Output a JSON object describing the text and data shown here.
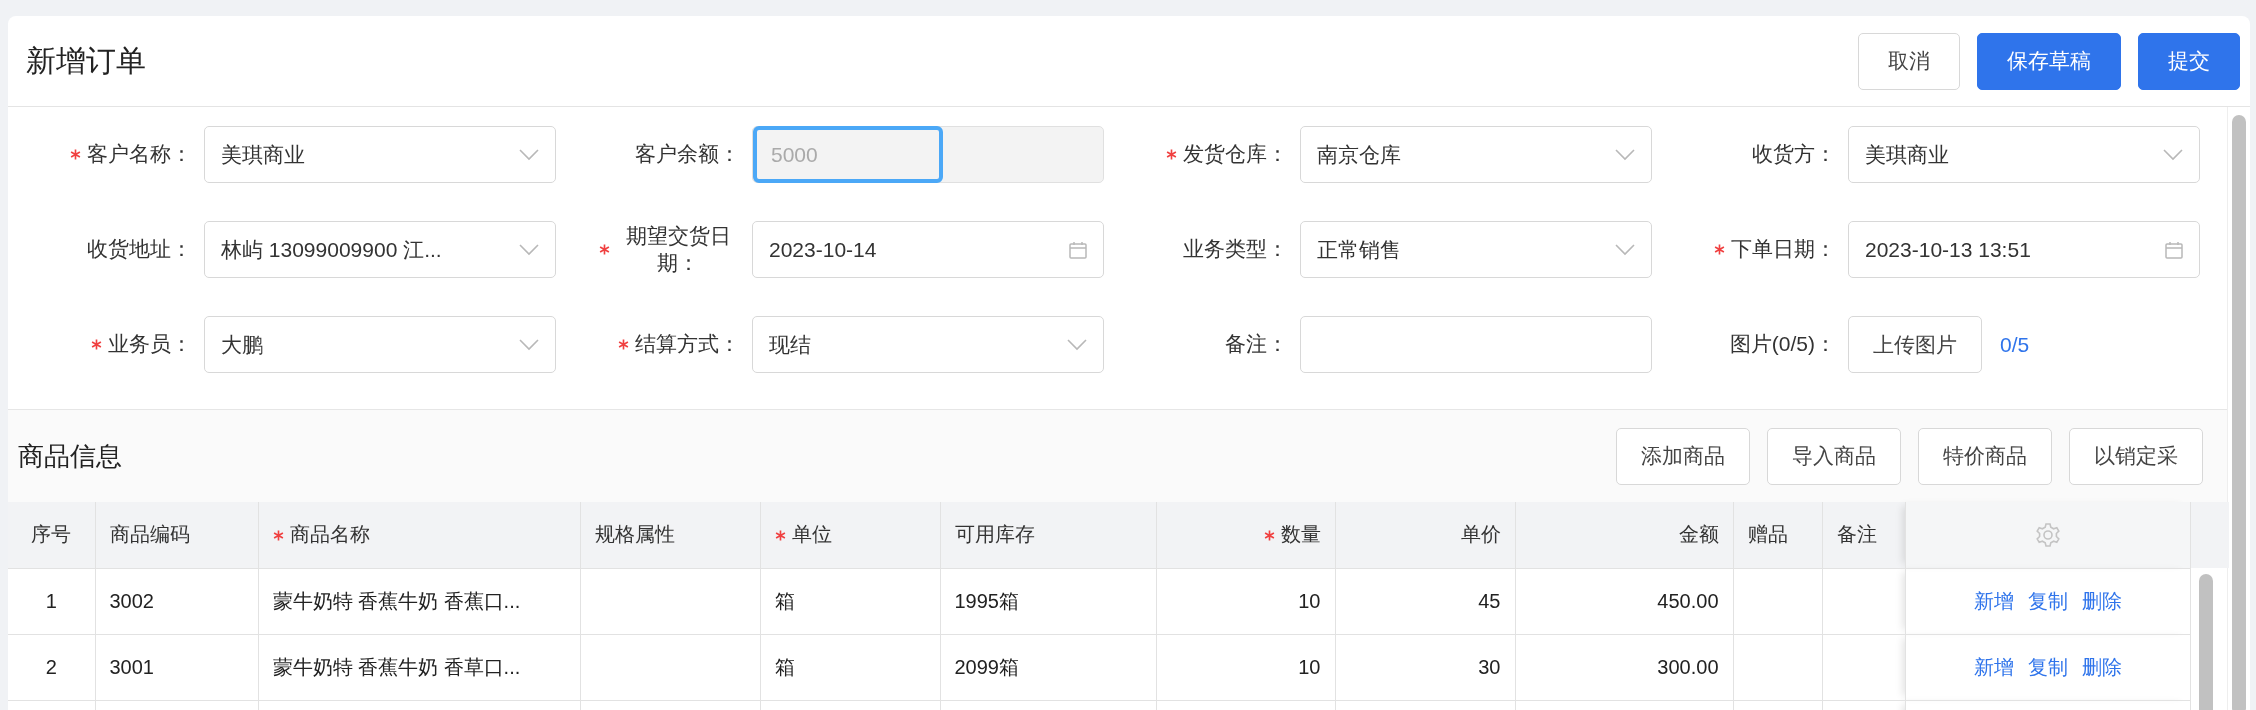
{
  "header": {
    "title": "新增订单",
    "buttons": [
      {
        "label": "取消",
        "kind": "default"
      },
      {
        "label": "保存草稿",
        "kind": "primary"
      },
      {
        "label": "提交",
        "kind": "primary"
      }
    ]
  },
  "form": {
    "fields": [
      {
        "label": "客户名称：",
        "required": true,
        "kind": "select",
        "value": "美琪商业"
      },
      {
        "label": "客户余额：",
        "required": false,
        "kind": "number",
        "value": "5000",
        "disabled": true,
        "focused": true
      },
      {
        "label": "发货仓库：",
        "required": true,
        "kind": "select",
        "value": "南京仓库"
      },
      {
        "label": "收货方：",
        "required": false,
        "kind": "select",
        "value": "美琪商业"
      },
      {
        "label": "收货地址：",
        "required": false,
        "kind": "select",
        "value": "林屿 13099009900 江..."
      },
      {
        "label": "期望交货日期：",
        "required": true,
        "kind": "date",
        "value": "2023-10-14"
      },
      {
        "label": "业务类型：",
        "required": false,
        "kind": "select",
        "value": "正常销售"
      },
      {
        "label": "下单日期：",
        "required": true,
        "kind": "date",
        "value": "2023-10-13 13:51"
      },
      {
        "label": "业务员：",
        "required": true,
        "kind": "select",
        "value": "大鹏"
      },
      {
        "label": "结算方式：",
        "required": true,
        "kind": "select",
        "value": "现结"
      },
      {
        "label": "备注：",
        "required": false,
        "kind": "text"
      },
      {
        "label": "图片(0/5)：",
        "required": false,
        "kind": "upload",
        "button": "上传图片",
        "count": "0/5"
      }
    ]
  },
  "goods": {
    "title": "商品信息",
    "buttons": [
      "添加商品",
      "导入商品",
      "特价商品",
      "以销定采"
    ],
    "table": {
      "columns": [
        {
          "label": "序号",
          "required": false
        },
        {
          "label": "商品编码",
          "required": false
        },
        {
          "label": "商品名称",
          "required": true
        },
        {
          "label": "规格属性",
          "required": false
        },
        {
          "label": "单位",
          "required": true
        },
        {
          "label": "可用库存",
          "required": false
        },
        {
          "label": "数量",
          "required": true
        },
        {
          "label": "单价",
          "required": false
        },
        {
          "label": "金额",
          "required": false
        },
        {
          "label": "赠品",
          "required": false
        },
        {
          "label": "备注",
          "required": false
        }
      ],
      "rows": [
        {
          "cells": [
            "1",
            "3002",
            "蒙牛奶特 香蕉牛奶 香蕉口...",
            null,
            "箱",
            "1995箱",
            "10",
            "45",
            "450.00",
            null,
            null
          ],
          "actions": [
            "新增",
            "复制",
            "删除"
          ]
        },
        {
          "cells": [
            "2",
            "3001",
            "蒙牛奶特 香蕉牛奶 香草口...",
            null,
            "箱",
            "2099箱",
            "10",
            "30",
            "300.00",
            null,
            null
          ],
          "actions": [
            "新增",
            "复制",
            "删除"
          ]
        }
      ]
    }
  }
}
